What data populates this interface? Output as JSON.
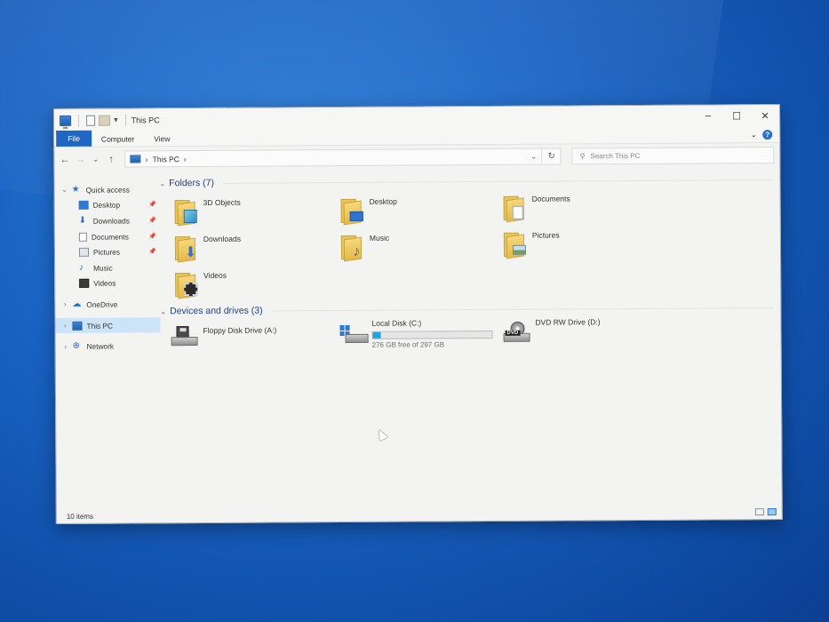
{
  "window": {
    "title": "This PC",
    "controls": {
      "minimize": "–",
      "maximize": "☐",
      "close": "✕"
    }
  },
  "ribbon": {
    "tabs": [
      {
        "label": "File",
        "active": true
      },
      {
        "label": "Computer",
        "active": false
      },
      {
        "label": "View",
        "active": false
      }
    ],
    "expand_glyph": "⌄",
    "help_glyph": "?"
  },
  "addressbar": {
    "path": [
      "This PC"
    ],
    "separator": "›",
    "search_placeholder": "Search This PC",
    "nav": {
      "back": "←",
      "forward": "→",
      "recent": "⌄",
      "up": "↑",
      "refresh": "↻",
      "dropdown": "⌄"
    }
  },
  "sidebar": {
    "items": [
      {
        "label": "Quick access",
        "icon": "star-icon",
        "level": "top",
        "expanded": true
      },
      {
        "label": "Desktop",
        "icon": "desktop-icon",
        "level": "sub",
        "pinned": true
      },
      {
        "label": "Downloads",
        "icon": "downloads-icon",
        "level": "sub",
        "pinned": true
      },
      {
        "label": "Documents",
        "icon": "documents-icon",
        "level": "sub",
        "pinned": true
      },
      {
        "label": "Pictures",
        "icon": "pictures-icon",
        "level": "sub",
        "pinned": true
      },
      {
        "label": "Music",
        "icon": "music-icon",
        "level": "sub",
        "pinned": false
      },
      {
        "label": "Videos",
        "icon": "videos-icon",
        "level": "sub",
        "pinned": false
      },
      {
        "label": "OneDrive",
        "icon": "onedrive-icon",
        "level": "top",
        "expanded": false
      },
      {
        "label": "This PC",
        "icon": "this-pc-icon",
        "level": "top",
        "expanded": false,
        "selected": true
      },
      {
        "label": "Network",
        "icon": "network-icon",
        "level": "top",
        "expanded": false
      }
    ],
    "pin_glyph": "📌"
  },
  "folders": {
    "heading": "Folders (7)",
    "items": [
      {
        "label": "3D Objects",
        "icon": "3d-objects-folder-icon"
      },
      {
        "label": "Desktop",
        "icon": "desktop-folder-icon"
      },
      {
        "label": "Documents",
        "icon": "documents-folder-icon"
      },
      {
        "label": "Downloads",
        "icon": "downloads-folder-icon"
      },
      {
        "label": "Music",
        "icon": "music-folder-icon"
      },
      {
        "label": "Pictures",
        "icon": "pictures-folder-icon"
      },
      {
        "label": "Videos",
        "icon": "videos-folder-icon"
      }
    ]
  },
  "drives": {
    "heading": "Devices and drives (3)",
    "items": [
      {
        "label": "Floppy Disk Drive (A:)",
        "icon": "floppy-drive-icon"
      },
      {
        "label": "Local Disk (C:)",
        "icon": "hard-disk-icon",
        "free_text": "276 GB free of 297 GB",
        "used_fraction": 0.07
      },
      {
        "label": "DVD RW Drive (D:)",
        "icon": "dvd-drive-icon",
        "badge": "DVD"
      }
    ]
  },
  "statusbar": {
    "item_count": "10 items"
  },
  "colors": {
    "accent": "#1e67c7",
    "selection": "#cce4f7",
    "heading": "#1e3f8a",
    "usage_bar": "#26a0da",
    "folder": "#e5b94a"
  }
}
